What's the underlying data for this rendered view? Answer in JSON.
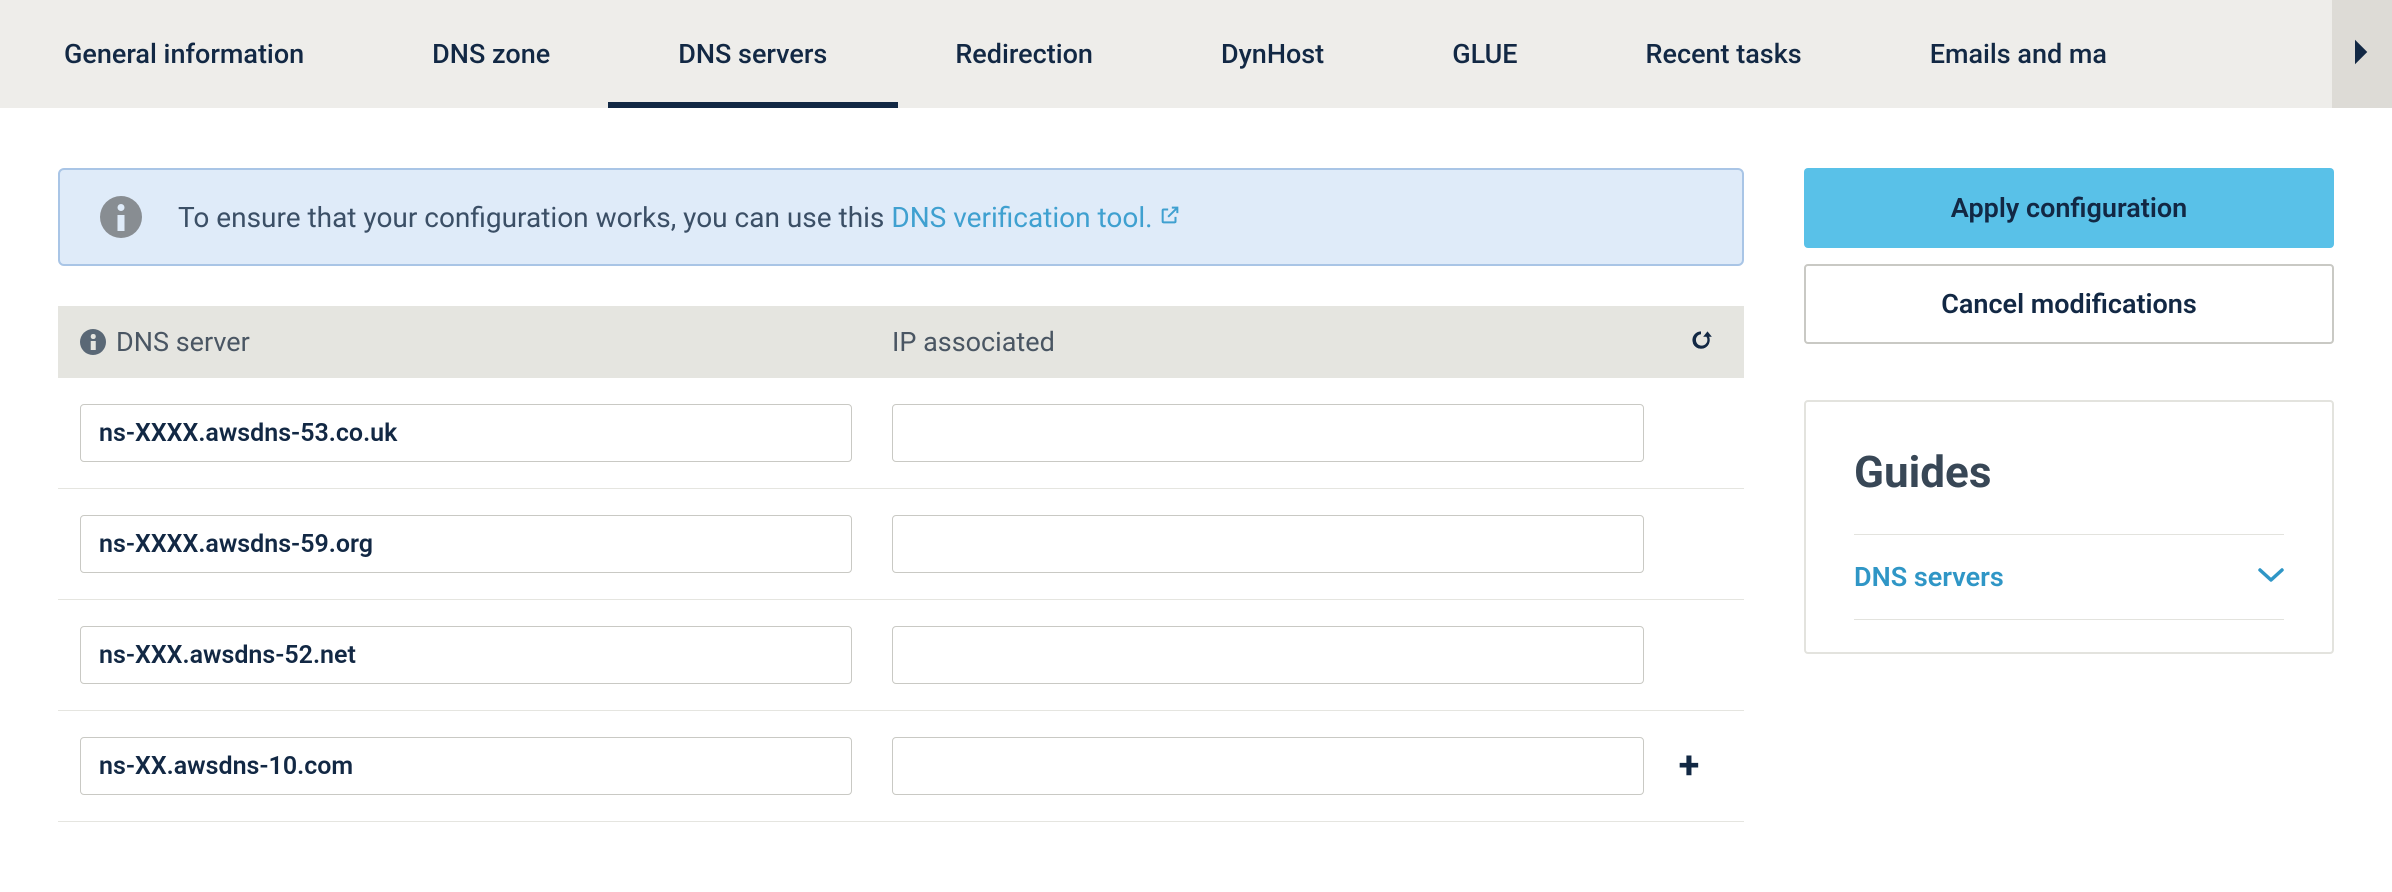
{
  "tabs": {
    "items": [
      {
        "label": "General information",
        "active": false
      },
      {
        "label": "DNS zone",
        "active": false
      },
      {
        "label": "DNS servers",
        "active": true
      },
      {
        "label": "Redirection",
        "active": false
      },
      {
        "label": "DynHost",
        "active": false
      },
      {
        "label": "GLUE",
        "active": false
      },
      {
        "label": "Recent tasks",
        "active": false
      },
      {
        "label": "Emails and ma",
        "active": false
      }
    ]
  },
  "info_banner": {
    "text": "To ensure that your configuration works, you can use this ",
    "link_text": "DNS verification tool."
  },
  "table": {
    "header": {
      "col1": "DNS server",
      "col2": "IP associated"
    },
    "rows": [
      {
        "server": "ns-XXXX.awsdns-53.co.uk",
        "ip": "",
        "can_add": false
      },
      {
        "server": "ns-XXXX.awsdns-59.org",
        "ip": "",
        "can_add": false
      },
      {
        "server": "ns-XXX.awsdns-52.net",
        "ip": "",
        "can_add": false
      },
      {
        "server": "ns-XX.awsdns-10.com",
        "ip": "",
        "can_add": true
      }
    ]
  },
  "actions": {
    "apply": "Apply configuration",
    "cancel": "Cancel modifications"
  },
  "guides": {
    "title": "Guides",
    "item": "DNS servers"
  }
}
